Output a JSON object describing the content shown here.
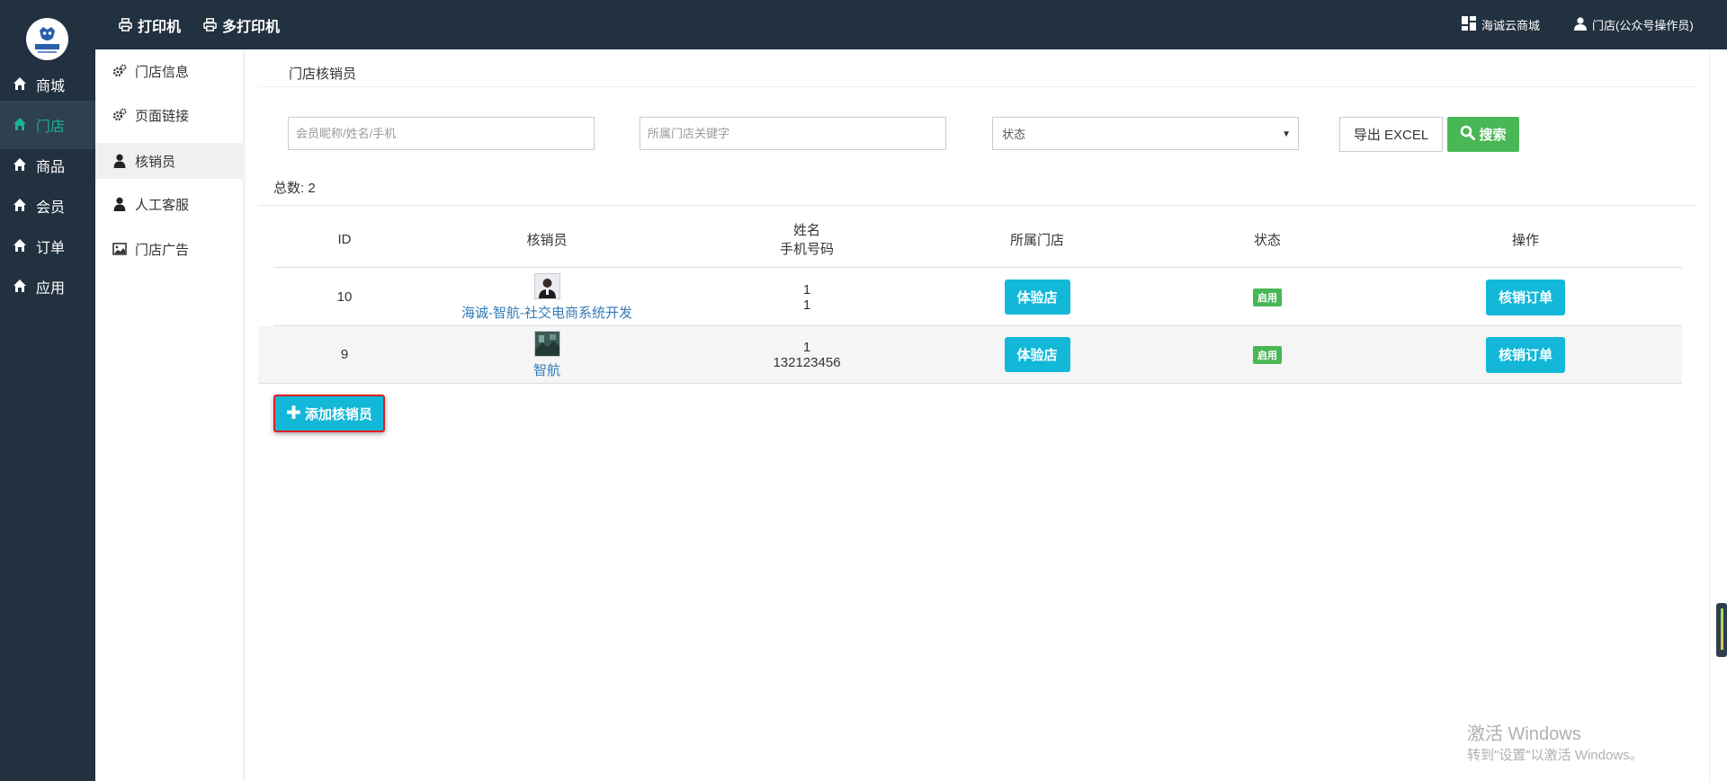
{
  "nav": {
    "items": [
      {
        "label": "商城",
        "active": false
      },
      {
        "label": "门店",
        "active": true
      },
      {
        "label": "商品",
        "active": false
      },
      {
        "label": "会员",
        "active": false
      },
      {
        "label": "订单",
        "active": false
      },
      {
        "label": "应用",
        "active": false
      }
    ]
  },
  "topbar": {
    "printer": "打印机",
    "multi_printer": "多打印机",
    "cloud_mall": "海诚云商城",
    "user": "门店(公众号操作员)"
  },
  "subnav": {
    "items": [
      {
        "label": "门店信息",
        "icon": "gears-icon"
      },
      {
        "label": "页面链接",
        "icon": "gears-icon"
      },
      {
        "label": "核销员",
        "icon": "user-icon",
        "active": true
      },
      {
        "label": "人工客服",
        "icon": "user-icon"
      },
      {
        "label": "门店广告",
        "icon": "image-icon"
      }
    ]
  },
  "page": {
    "title": "门店核销员",
    "search_member_placeholder": "会员昵称/姓名/手机",
    "search_store_placeholder": "所属门店关键字",
    "status_select": "状态",
    "export_label": "导出 EXCEL",
    "search_label": "搜索",
    "total_label": "总数: 2",
    "add_label": "添加核销员"
  },
  "table": {
    "headers": {
      "id": "ID",
      "verifier": "核销员",
      "name": "姓名",
      "phone": "手机号码",
      "store": "所属门店",
      "status": "状态",
      "action": "操作"
    },
    "rows": [
      {
        "id": "10",
        "verifier": "海诚-智航-社交电商系统开发",
        "name": "1",
        "phone": "1",
        "store": "体验店",
        "status": "启用",
        "action": "核销订单"
      },
      {
        "id": "9",
        "verifier": "智航",
        "name": "1",
        "phone": "132123456",
        "store": "体验店",
        "status": "启用",
        "action": "核销订单"
      }
    ]
  },
  "watermark": {
    "line1": "激活 Windows",
    "line2": "转到\"设置\"以激活 Windows。"
  },
  "colors": {
    "sidebar_bg": "#22313f",
    "accent_green": "#1ab394",
    "button_cyan": "#13b8d8",
    "button_green": "#48b755",
    "link_blue": "#337ab7"
  }
}
